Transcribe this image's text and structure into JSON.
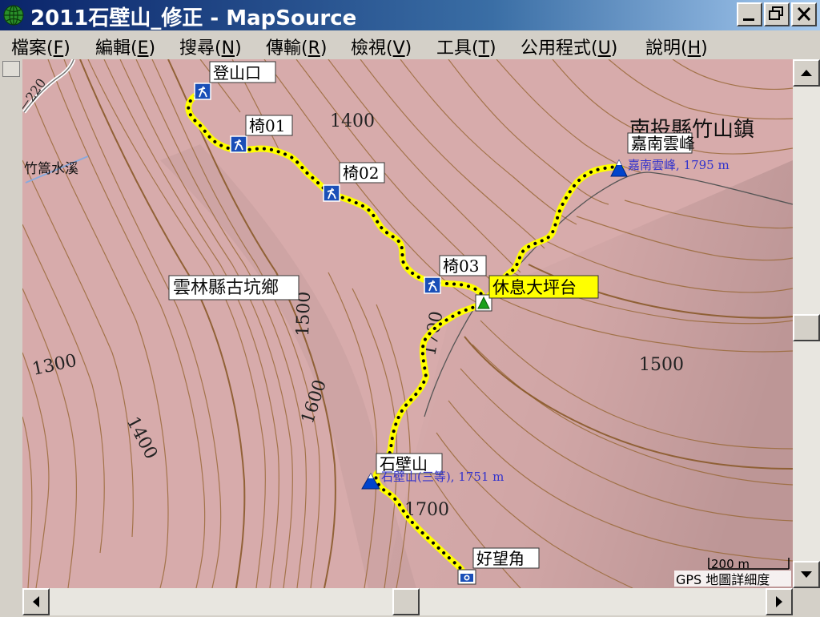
{
  "window": {
    "title": "2011石壁山_修正 - MapSource"
  },
  "menu": [
    {
      "label": "檔案(",
      "key": "F",
      "tail": ")"
    },
    {
      "label": "編輯(",
      "key": "E",
      "tail": ")"
    },
    {
      "label": "搜尋(",
      "key": "N",
      "tail": ")"
    },
    {
      "label": "傳輸(",
      "key": "R",
      "tail": ")"
    },
    {
      "label": "檢視(",
      "key": "V",
      "tail": ")"
    },
    {
      "label": "工具(",
      "key": "T",
      "tail": ")"
    },
    {
      "label": "公用程式(",
      "key": "U",
      "tail": ")"
    },
    {
      "label": "說明(",
      "key": "H",
      "tail": ")"
    }
  ],
  "map": {
    "colors": {
      "terrain": "#d7abab",
      "contour": "#9a6a3a",
      "track": "#ffff00",
      "track_dots": "#000000",
      "peak_blue": "#0044cc",
      "label_blue": "#3333cc"
    },
    "contour_labels": [
      "1400",
      "1500",
      "1300",
      "1400",
      "1600",
      "1700",
      "1500",
      "1700"
    ],
    "road_label": "ᅳ220",
    "region_labels": {
      "town_nantou": "南投縣竹山鎮",
      "town_yunlin": "雲林縣古坑鄉",
      "stream": "竹篙水溪"
    },
    "waypoints": {
      "trailhead": "登山口",
      "chair01": "椅01",
      "chair02": "椅02",
      "chair03": "椅03",
      "rest_area": "休息大坪台",
      "jianan_peak": "嘉南雲峰",
      "shibi_peak": "石壁山",
      "viewpoint": "好望角"
    },
    "peak_labels": {
      "jianan_detail": "嘉南雲峰, 1795 m",
      "shibi_detail": "石壁山(三等), 1751 m"
    },
    "scale": {
      "distance": "200 m",
      "caption": "GPS 地圖詳細度"
    }
  }
}
